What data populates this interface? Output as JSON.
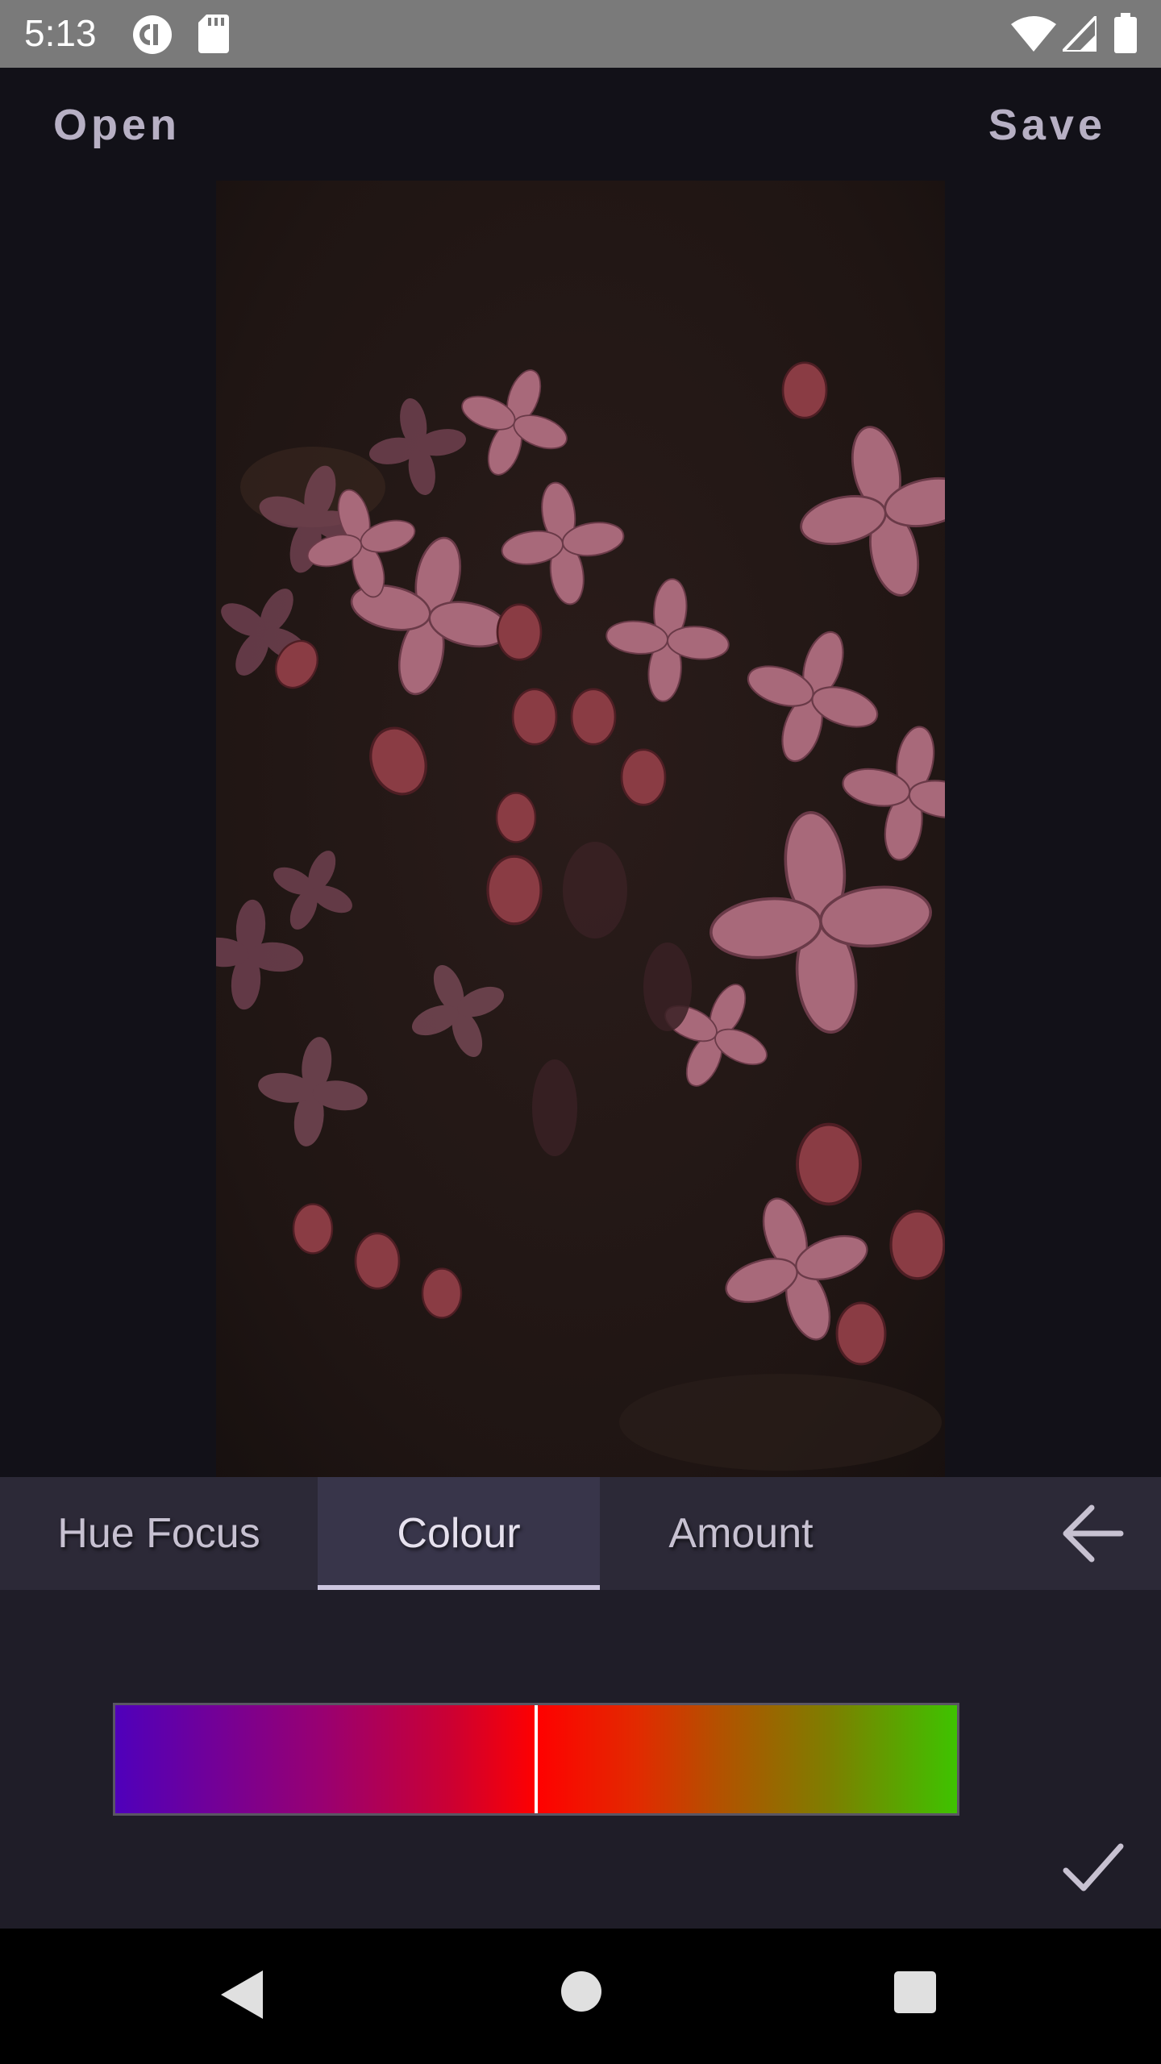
{
  "status_bar": {
    "time": "5:13",
    "left_icons": [
      "pocket-casts-icon",
      "sd-card-icon"
    ],
    "right_icons": [
      "wifi-icon",
      "cell-signal-icon",
      "battery-icon"
    ]
  },
  "top_bar": {
    "open_label": "Open",
    "save_label": "Save"
  },
  "image": {
    "subject": "lilac-flowers-photo"
  },
  "tabs": [
    {
      "label": "Hue Focus",
      "selected": false
    },
    {
      "label": "Colour",
      "selected": true
    },
    {
      "label": "Amount",
      "selected": false
    }
  ],
  "controls": {
    "back_icon": "arrow-left-icon",
    "confirm_icon": "check-icon",
    "colour_slider_value": 0.5,
    "gradient_colors": [
      "#4f00bb",
      "#9a0070",
      "#cc0032",
      "#ff0000",
      "#e22a00",
      "#b25200",
      "#7d7f00",
      "#3ec300"
    ]
  },
  "nav_bar": {
    "buttons": [
      "back-triangle-icon",
      "home-circle-icon",
      "recents-square-icon"
    ]
  },
  "colors": {
    "status_bar": "#7a7a7a",
    "background": "#121118",
    "tab_bar": "#2c2937",
    "selected_tab": "#38354a",
    "panel": "#1f1d28",
    "text": "#c7c1d1"
  }
}
